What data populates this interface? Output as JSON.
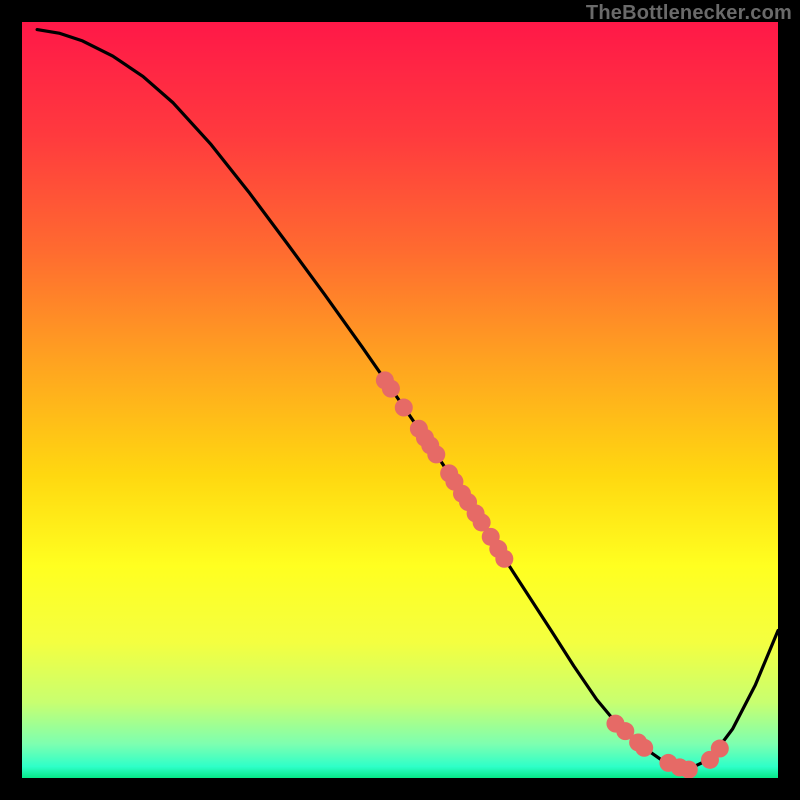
{
  "attribution": "TheBottlenecker.com",
  "colors": {
    "frame": "#000000",
    "line": "#000000",
    "point": "#e66a66",
    "gradient_stops": [
      {
        "offset": 0.0,
        "color": "#ff1848"
      },
      {
        "offset": 0.15,
        "color": "#ff3a3e"
      },
      {
        "offset": 0.3,
        "color": "#ff6a30"
      },
      {
        "offset": 0.45,
        "color": "#ffa320"
      },
      {
        "offset": 0.6,
        "color": "#ffd810"
      },
      {
        "offset": 0.72,
        "color": "#ffff20"
      },
      {
        "offset": 0.82,
        "color": "#f4ff40"
      },
      {
        "offset": 0.9,
        "color": "#c8ff70"
      },
      {
        "offset": 0.955,
        "color": "#7dffb0"
      },
      {
        "offset": 0.985,
        "color": "#2effc8"
      },
      {
        "offset": 1.0,
        "color": "#06e888"
      }
    ]
  },
  "chart_data": {
    "type": "line",
    "title": "",
    "xlabel": "",
    "ylabel": "",
    "xlim": [
      0,
      100
    ],
    "ylim": [
      0,
      100
    ],
    "series": [
      {
        "name": "curve",
        "x": [
          2,
          5,
          8,
          12,
          16,
          20,
          25,
          30,
          35,
          40,
          45,
          50,
          55,
          60,
          65,
          70,
          73,
          76,
          79,
          82,
          85,
          88,
          91,
          94,
          97,
          100
        ],
        "y": [
          99,
          98.5,
          97.5,
          95.5,
          92.8,
          89.3,
          83.8,
          77.5,
          70.8,
          64,
          57,
          49.8,
          42.5,
          35,
          27.2,
          19.5,
          14.8,
          10.4,
          6.8,
          4.2,
          2.1,
          1.1,
          2.5,
          6.5,
          12.3,
          19.5
        ]
      }
    ],
    "points": [
      {
        "x": 48.0,
        "y": 52.6
      },
      {
        "x": 48.8,
        "y": 51.5
      },
      {
        "x": 50.5,
        "y": 49.0
      },
      {
        "x": 52.5,
        "y": 46.2
      },
      {
        "x": 53.3,
        "y": 45.0
      },
      {
        "x": 54.0,
        "y": 44.0
      },
      {
        "x": 54.8,
        "y": 42.8
      },
      {
        "x": 56.5,
        "y": 40.3
      },
      {
        "x": 57.2,
        "y": 39.2
      },
      {
        "x": 58.2,
        "y": 37.6
      },
      {
        "x": 59.0,
        "y": 36.5
      },
      {
        "x": 60.0,
        "y": 35.0
      },
      {
        "x": 60.8,
        "y": 33.8
      },
      {
        "x": 62.0,
        "y": 31.9
      },
      {
        "x": 63.0,
        "y": 30.3
      },
      {
        "x": 63.8,
        "y": 29.0
      },
      {
        "x": 78.5,
        "y": 7.2
      },
      {
        "x": 79.8,
        "y": 6.2
      },
      {
        "x": 81.5,
        "y": 4.7
      },
      {
        "x": 82.3,
        "y": 4.0
      },
      {
        "x": 85.5,
        "y": 2.0
      },
      {
        "x": 87.0,
        "y": 1.4
      },
      {
        "x": 88.2,
        "y": 1.1
      },
      {
        "x": 91.0,
        "y": 2.4
      },
      {
        "x": 92.3,
        "y": 3.9
      }
    ]
  }
}
